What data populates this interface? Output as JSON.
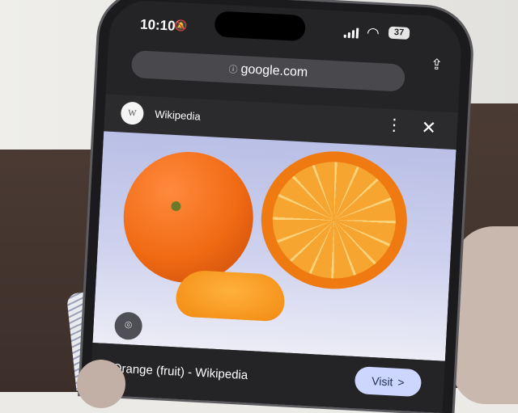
{
  "status_bar": {
    "time": "10:10",
    "battery": "37"
  },
  "browser": {
    "url": "google.com"
  },
  "source": {
    "avatar_letter": "W",
    "name": "Wikipedia"
  },
  "result": {
    "title": "Orange (fruit) - Wikipedia",
    "visit_label": "Visit",
    "visit_arrow": ">"
  },
  "icons": {
    "mute": "bell-slash-icon",
    "signal": "cellular-signal-icon",
    "wifi": "wifi-icon",
    "lock": "site-info-icon",
    "share": "share-icon",
    "more": "more-vertical-icon",
    "close": "close-icon",
    "lens": "lens-search-icon"
  },
  "colors": {
    "visit_button": "#cdd6ff",
    "browser_chrome": "#242426"
  }
}
